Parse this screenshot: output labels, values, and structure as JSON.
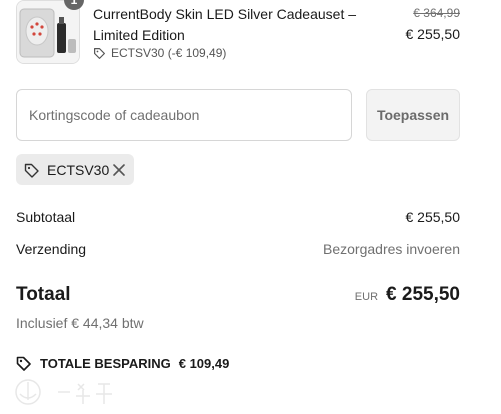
{
  "product": {
    "quantity": "1",
    "title": "CurrentBody Skin LED Silver Cadeauset – Limited Edition",
    "discount_code_label": "ECTSV30 (-€ 109,49)",
    "original_price": "€ 364,99",
    "price": "€ 255,50",
    "icon": "tag-icon"
  },
  "discount_form": {
    "placeholder": "Kortingscode of cadeaubon",
    "value": "",
    "apply_label": "Toepassen"
  },
  "applied_code": {
    "label": "ECTSV30",
    "icons": [
      "tag-icon",
      "close-icon"
    ]
  },
  "summary": {
    "subtotal_label": "Subtotaal",
    "subtotal_value": "€ 255,50",
    "shipping_label": "Verzending",
    "shipping_value": "Bezorgadres invoeren",
    "total_label": "Totaal",
    "currency_code": "EUR",
    "total_value": "€ 255,50",
    "tax_line": "Inclusief € 44,34 btw",
    "savings_label": "TOTALE BESPARING",
    "savings_value": "€ 109,49"
  },
  "colors": {
    "text": "#1a1a1a",
    "muted": "#707070",
    "chip_bg": "#ebebeb",
    "button_bg": "#f3f3f3",
    "badge_bg": "#666666"
  }
}
